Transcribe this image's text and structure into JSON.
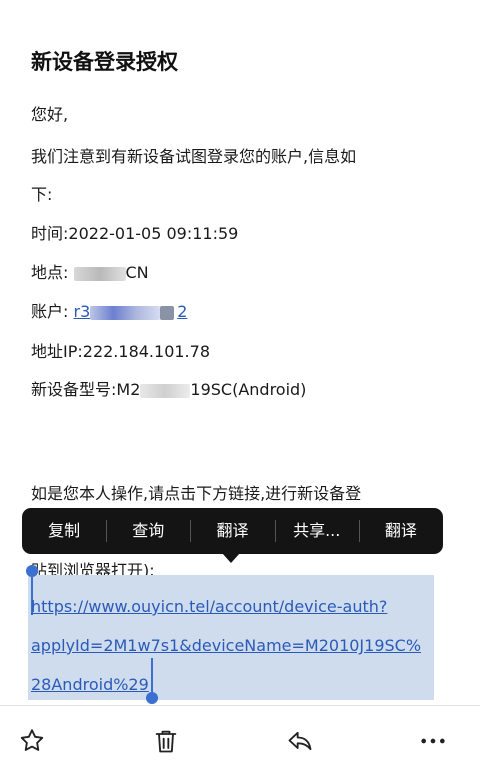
{
  "email": {
    "title": "新设备登录授权",
    "greeting": "您好,",
    "intro_line1": "我们注意到有新设备试图登录您的账户,信息如",
    "intro_line2": "下:",
    "time_label": "时间:",
    "time_value": "2022-01-05 09:11:59",
    "location_label": "地点:",
    "location_value": "CN",
    "account_label": "账户:",
    "account_value_start": "r3",
    "account_value_end": "2",
    "ip_label": "地址IP:",
    "ip_value": "222.184.101.78",
    "device_label": "新设备型号:",
    "device_value_start": "M2",
    "device_value_end": "19SC(Android)",
    "action_line": "如是您本人操作,请点击下方链接,进行新设备登",
    "copy_hint": "贴到浏览器打开):",
    "link_line1": "https://www.ouyicn.tel/account/device-auth?",
    "link_line2": "applyId=2M1w7s1&deviceName=M2010J19SC%",
    "link_line3": "28Android%29"
  },
  "context_menu": {
    "items": [
      "复制",
      "查询",
      "翻译",
      "共享...",
      "翻译"
    ]
  },
  "toolbar": {
    "icons": [
      "star-icon",
      "trash-icon",
      "reply-icon",
      "more-icon"
    ]
  },
  "colors": {
    "link": "#2a5bb8",
    "selection": "#cfdcee",
    "handle": "#3b6fd0",
    "menu_bg": "#141414"
  }
}
